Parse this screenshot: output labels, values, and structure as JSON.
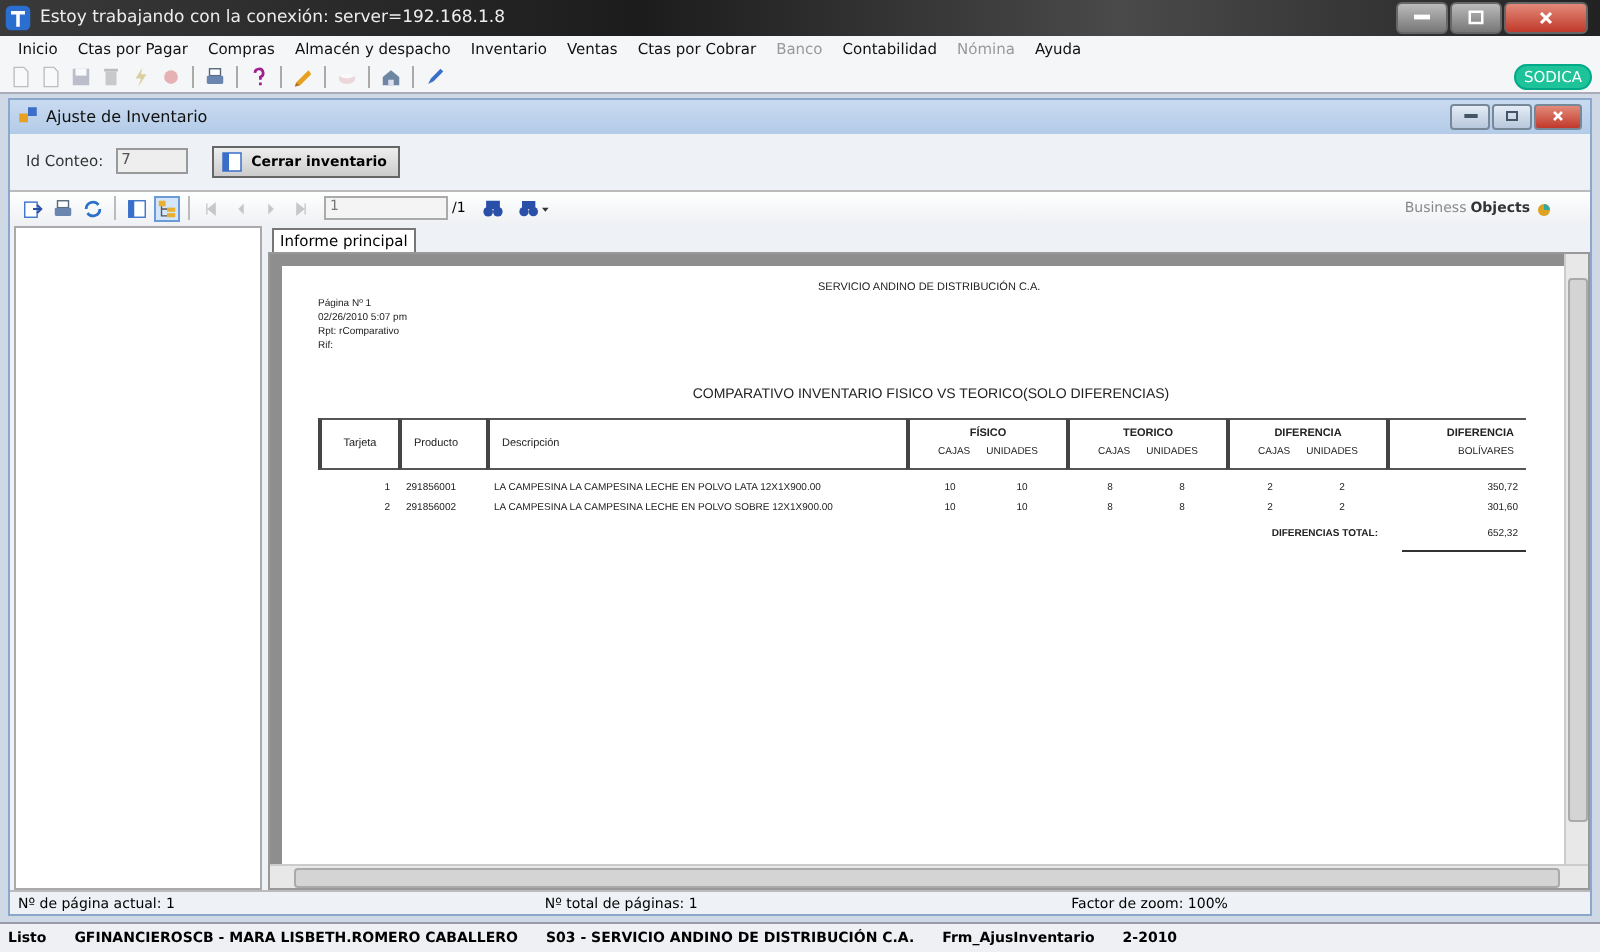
{
  "window": {
    "title": "Estoy trabajando con la conexión: server=192.168.1.8"
  },
  "menu": [
    {
      "label": "Inicio",
      "disabled": false
    },
    {
      "label": "Ctas por Pagar",
      "disabled": false
    },
    {
      "label": "Compras",
      "disabled": false
    },
    {
      "label": "Almacén y despacho",
      "disabled": false
    },
    {
      "label": "Inventario",
      "disabled": false
    },
    {
      "label": "Ventas",
      "disabled": false
    },
    {
      "label": "Ctas por Cobrar",
      "disabled": false
    },
    {
      "label": "Banco",
      "disabled": true
    },
    {
      "label": "Contabilidad",
      "disabled": false
    },
    {
      "label": "Nómina",
      "disabled": true
    },
    {
      "label": "Ayuda",
      "disabled": false
    }
  ],
  "toolbar": [
    [
      {
        "kind": "document",
        "disabled": true
      },
      {
        "kind": "document",
        "disabled": true
      },
      {
        "kind": "save",
        "disabled": true
      },
      {
        "kind": "trash",
        "disabled": true
      },
      {
        "kind": "lightning",
        "disabled": true
      },
      {
        "kind": "circle",
        "disabled": true
      }
    ],
    [
      {
        "kind": "printer",
        "disabled": false
      }
    ],
    [
      {
        "kind": "help",
        "disabled": false
      }
    ],
    [
      {
        "kind": "broom",
        "disabled": false
      }
    ],
    [
      {
        "kind": "cup",
        "disabled": true
      }
    ],
    [
      {
        "kind": "house",
        "disabled": false
      }
    ],
    [
      {
        "kind": "pen",
        "disabled": false
      }
    ]
  ],
  "brand": {
    "label": "SODICA"
  },
  "child": {
    "title": "Ajuste de Inventario",
    "id_label": "Id Conteo:",
    "id_value": "7",
    "close_button": "Cerrar inventario"
  },
  "viewer": {
    "toolbar": [
      [
        {
          "kind": "export",
          "disabled": false,
          "pressed": false
        },
        {
          "kind": "printer",
          "disabled": false,
          "pressed": false
        },
        {
          "kind": "refresh",
          "disabled": false,
          "pressed": false
        }
      ],
      [
        {
          "kind": "panel",
          "disabled": false,
          "pressed": false
        },
        {
          "kind": "tree",
          "disabled": false,
          "pressed": true
        }
      ],
      [
        {
          "kind": "first",
          "disabled": true,
          "pressed": false
        },
        {
          "kind": "prev",
          "disabled": true,
          "pressed": false
        },
        {
          "kind": "next",
          "disabled": true,
          "pressed": false
        },
        {
          "kind": "last",
          "disabled": true,
          "pressed": false
        }
      ]
    ],
    "page_field": "1",
    "page_total": "/1",
    "logo_a": "Business",
    "logo_b": "Objects",
    "tabs": [
      {
        "label": "Informe principal",
        "selected": true
      }
    ]
  },
  "report": {
    "company": "SERVICIO ANDINO DE DISTRIBUCIÓN C.A.",
    "meta": [
      {
        "label": "Página Nº",
        "value": "1"
      },
      {
        "label": "02/26/2010",
        "value": "5:07 pm"
      },
      {
        "label": "Rpt:",
        "value": "rComparativo"
      },
      {
        "label": "Rif:"
      }
    ],
    "title": "COMPARATIVO INVENTARIO FISICO VS TEORICO(SOLO DIFERENCIAS)",
    "columns": [
      "Tarjeta",
      "Producto",
      "Descripción"
    ],
    "groups": [
      {
        "title": "FÍSICO",
        "sub": [
          "CAJAS",
          "UNIDADES"
        ]
      },
      {
        "title": "TEORICO",
        "sub": [
          "CAJAS",
          "UNIDADES"
        ]
      },
      {
        "title": "DIFERENCIA",
        "sub": [
          "CAJAS",
          "UNIDADES"
        ]
      }
    ],
    "amount_column": [
      "DIFERENCIA",
      "BOLÍVARES"
    ],
    "rows": [
      {
        "tarjeta": "1",
        "producto": "291856001",
        "descripcion": "LA CAMPESINA LA CAMPESINA LECHE EN POLVO LATA 12X1X900.00",
        "values": [
          "10",
          "10",
          "8",
          "8",
          "2",
          "2"
        ],
        "amount": "350,72"
      },
      {
        "tarjeta": "2",
        "producto": "291856002",
        "descripcion": "LA CAMPESINA LA CAMPESINA LECHE EN POLVO SOBRE 12X1X900.00",
        "values": [
          "10",
          "10",
          "8",
          "8",
          "2",
          "2"
        ],
        "amount": "301,60"
      }
    ],
    "total_label": "DIFERENCIAS TOTAL:",
    "total": "652,32"
  },
  "status": [
    "Nº de página actual: 1",
    "Nº total de páginas: 1",
    "Factor de zoom: 100%"
  ],
  "app_status": [
    "Listo",
    "GFINANCIEROSCB - MARA LISBETH.ROMERO CABALLERO",
    "S03 - SERVICIO ANDINO DE DISTRIBUCIÓN C.A.",
    "Frm_AjusInventario",
    "2-2010"
  ]
}
